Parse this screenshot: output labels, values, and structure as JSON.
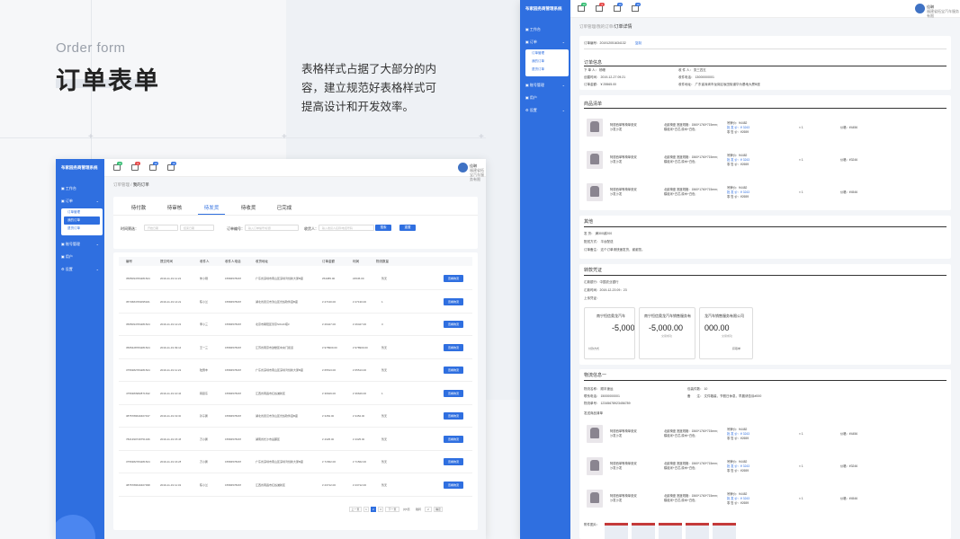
{
  "intro": {
    "en_title": "Order form",
    "cn_title": "订单表单",
    "description": "表格样式占据了大部分的内容，建立规范好表格样式可提高设计和开发效率。"
  },
  "app": {
    "brand": "布家园务商管理系统",
    "notifications": [
      {
        "icon": "bell-icon",
        "count": "10",
        "color": "#2dbb6d"
      },
      {
        "icon": "cart-icon",
        "count": "4",
        "color": "#e64b4b"
      },
      {
        "icon": "chat-icon",
        "count": "10",
        "color": "#2f6fe0"
      },
      {
        "icon": "doc-icon",
        "count": "10",
        "color": "#2f6fe0"
      }
    ],
    "user": {
      "name": "佳琳",
      "org": "福建省拓宝汽车服务有限"
    },
    "sidebar": {
      "workbench": "工作台",
      "orders": "订单",
      "order_sub": [
        "订单管理",
        "我的订单",
        "退货订单"
      ],
      "account_mgmt": "账号管理",
      "users": "用户",
      "settings": "设置"
    }
  },
  "order_list": {
    "breadcrumb_parent": "订单管理",
    "breadcrumb_current": "我的订单",
    "tabs": [
      "待付款",
      "待审核",
      "待发货",
      "待收货",
      "已完成"
    ],
    "active_tab": 2,
    "filters": {
      "time_label": "时间筛选：",
      "start_placeholder": "开始日期",
      "end_placeholder": "结束日期",
      "order_label": "订单编号：",
      "order_placeholder": "输入订单编号/标题",
      "receiver_label": "收货人：",
      "receiver_placeholder": "输入收货人名称/电话号码",
      "search_btn": "搜索",
      "reset_btn": "重置"
    },
    "columns": [
      "编号",
      "提交时间",
      "收件人",
      "收件人电话",
      "收货地址",
      "订单金额",
      "利润",
      "物流数量",
      ""
    ],
    "rows": [
      {
        "id": "3565094784281524",
        "time": "2019-11-19 11:22",
        "name": "朱小刚",
        "phone": "15584578297",
        "addr": "广东省深圳市南山区深圳湾创新大厦B座",
        "amount": "¥54385.00",
        "profit": "¥4545.00",
        "logistics": "暂无",
        "btn": "查看物流"
      },
      {
        "id": "3573684784095321",
        "time": "2019-11-19 14:22",
        "name": "陈小兰",
        "phone": "15584578297",
        "addr": "湖北省武汉市洪山区光谷软件园B座",
        "amount": "¥ 27130.00",
        "profit": "¥ 27130.00",
        "logistics": "1",
        "btn": "查看物流"
      },
      {
        "id": "3565094784281524",
        "time": "2019-11-19 12:21",
        "name": "李小三",
        "phone": "15584578297",
        "addr": "北京市朝阳区望京SOHO塔3",
        "amount": "¥ 26427.00",
        "profit": "¥ 26427.00",
        "logistics": "3",
        "btn": "查看物流"
      },
      {
        "id": "3565428784281524",
        "time": "2019-11-19 09:14",
        "name": "王一三",
        "phone": "15584578297",
        "addr": "江苏省南京市鼓楼区中央门街道",
        "amount": "¥ 978909.00",
        "profit": "¥ 978909.00",
        "logistics": "暂无",
        "btn": "查看物流"
      },
      {
        "id": "3756382784281524",
        "time": "2019-11-19 11:22",
        "name": "陆惠丰",
        "phone": "15584578297",
        "addr": "广东省深圳市南山区深圳湾创新大厦B座",
        "amount": "¥ 65513.00",
        "profit": "¥ 65513.00",
        "logistics": "暂无",
        "btn": "查看物流"
      },
      {
        "id": "4756383982871632",
        "time": "2019-11-19 10:44",
        "name": "韩思东",
        "phone": "15584578297",
        "addr": "江西省南昌市红谷滩新区",
        "amount": "¥ 36629.00",
        "profit": "¥ 36629.00",
        "logistics": "1",
        "btn": "查看物流"
      },
      {
        "id": "3875789640407437",
        "time": "2019-11-19 19:30",
        "name": "孙子鹏",
        "phone": "15584578297",
        "addr": "湖北省武汉市洪山区光谷软件园B座",
        "amount": "¥ 3452.00",
        "profit": "¥ 3452.00",
        "logistics": "暂无",
        "btn": "查看物流"
      },
      {
        "id": "7821390749751346",
        "time": "2019-11-19 15:46",
        "name": "万小鹏",
        "phone": "15584578297",
        "addr": "湖南省长沙市岳麓区",
        "amount": "¥ 4325.00",
        "profit": "¥ 4325.00",
        "logistics": "暂无",
        "btn": "查看物流"
      },
      {
        "id": "3756382784281524",
        "time": "2019-11-19 16:28",
        "name": "万小鹏",
        "phone": "15584578297",
        "addr": "广东省深圳市南山区深圳湾创新大厦B座",
        "amount": "¥ 71562.00",
        "profit": "¥ 71562.00",
        "logistics": "暂无",
        "btn": "查看物流"
      },
      {
        "id": "3875789640407398",
        "time": "2019-11-19 11:32",
        "name": "陈小兰",
        "phone": "15584578297",
        "addr": "江西省南昌市红谷滩新区",
        "amount": "¥ 23712.00",
        "profit": "¥ 23712.00",
        "logistics": "暂无",
        "btn": "查看物流"
      }
    ],
    "pagination": {
      "prev": "上一页",
      "pages": [
        "1",
        "2",
        "3"
      ],
      "next": "下一页",
      "total": "共5页",
      "goto": "跳转",
      "page_input": "2",
      "confirm": "确定"
    }
  },
  "order_detail": {
    "breadcrumb_parent": "订单管理/我的订单",
    "breadcrumb_current": "订单详情",
    "order_no_label": "订单编号：",
    "order_no": "201912051634132",
    "copy": "复制",
    "info": {
      "title": "订单信息",
      "buyer_label": "下 单 人：",
      "buyer": "杨珊",
      "seller_label": "收 件 人：",
      "seller": "张三四五",
      "created_label": "创建时间：",
      "created": "2019-12-27 09:21",
      "phone_label": "收件电话：",
      "phone": "13000000001",
      "amount_label": "订单金额：",
      "amount": "¥ 25565.00",
      "address_label": "收件地址：",
      "address": "广东省深圳市龙岗区坂田街道华为基地大厦B座"
    },
    "products": {
      "title": "商品清单",
      "items": [
        {
          "name1": "阿德西单等椅单张双",
          "name2": "沙发沙发",
          "spec1": "北欧椅座 宽度规格：1560*1760*715mm;",
          "spec2": "模组米+白芯,原木+白色;",
          "p1": "吊牌价：¥4482",
          "p2": "批 发 价：¥ 3243",
          "p3": "零 售 价：¥2659",
          "qty": "× 1",
          "total": "价格：¥4456"
        },
        {
          "name1": "阿德西单等椅单张双",
          "name2": "沙发沙发",
          "spec1": "北欧椅座 宽度规格：1560*1760*715mm;",
          "spec2": "模组米+白芯,原木+白色;",
          "p1": "吊牌价：¥4482",
          "p2": "批 发 价：¥ 3243",
          "p3": "零 售 价：¥2659",
          "qty": "× 1",
          "total": "价格：¥3246"
        },
        {
          "name1": "阿德西单等椅单张双",
          "name2": "沙发沙发",
          "spec1": "北欧椅座 宽度规格：1560*1760*715mm;",
          "spec2": "模组米+白芯,原木+白色;",
          "p1": "吊牌价：¥4482",
          "p2": "批 发 价：¥ 3243",
          "p3": "零 售 价：¥2659",
          "qty": "× 1",
          "total": "价格：¥4546"
        }
      ]
    },
    "other": {
      "title": "其他",
      "shipping_label": "发 货：",
      "shipping": "满300减200",
      "delivery_label": "配送方式：",
      "delivery": "平台配送",
      "note_label": "订单备注：",
      "note": "这个订单请快速发货，谢谢您。"
    },
    "transfer": {
      "title": "转款凭证",
      "bank_label": "汇款银行：",
      "bank": "中国农业银行",
      "time_label": "汇款时间：",
      "time": "2019-12-23 09：23",
      "upload_label": "上传凭证：",
      "vouchers": [
        {
          "merchant": "南宁恒信奥龙汽车",
          "amount": "-5,000.",
          "status": "",
          "footer": "付款方式"
        },
        {
          "merchant": "南宁恒信奥龙汽车销售服务有",
          "amount": "-5,000.00",
          "status": "交易成功",
          "footer": ""
        },
        {
          "merchant": "龙汽车销售服务有限公司",
          "amount": "000.00",
          "status": "交易成功",
          "footer": "获取单"
        }
      ]
    },
    "logistics": {
      "title": "物流信息一",
      "company_label": "物流名称：",
      "company": "顺丰速运",
      "items_label": "包装件数：",
      "items": "10",
      "contact_label": "联系电话：",
      "contact": "15000000001",
      "remark_label": "备　　注：",
      "remark": "文件箱装，节假日休息，早晨请告诉#000",
      "tracking_label": "物流单号：",
      "tracking": "12345678923456789",
      "list_title": "发送商品清单",
      "attach_label": "附件图片："
    }
  }
}
